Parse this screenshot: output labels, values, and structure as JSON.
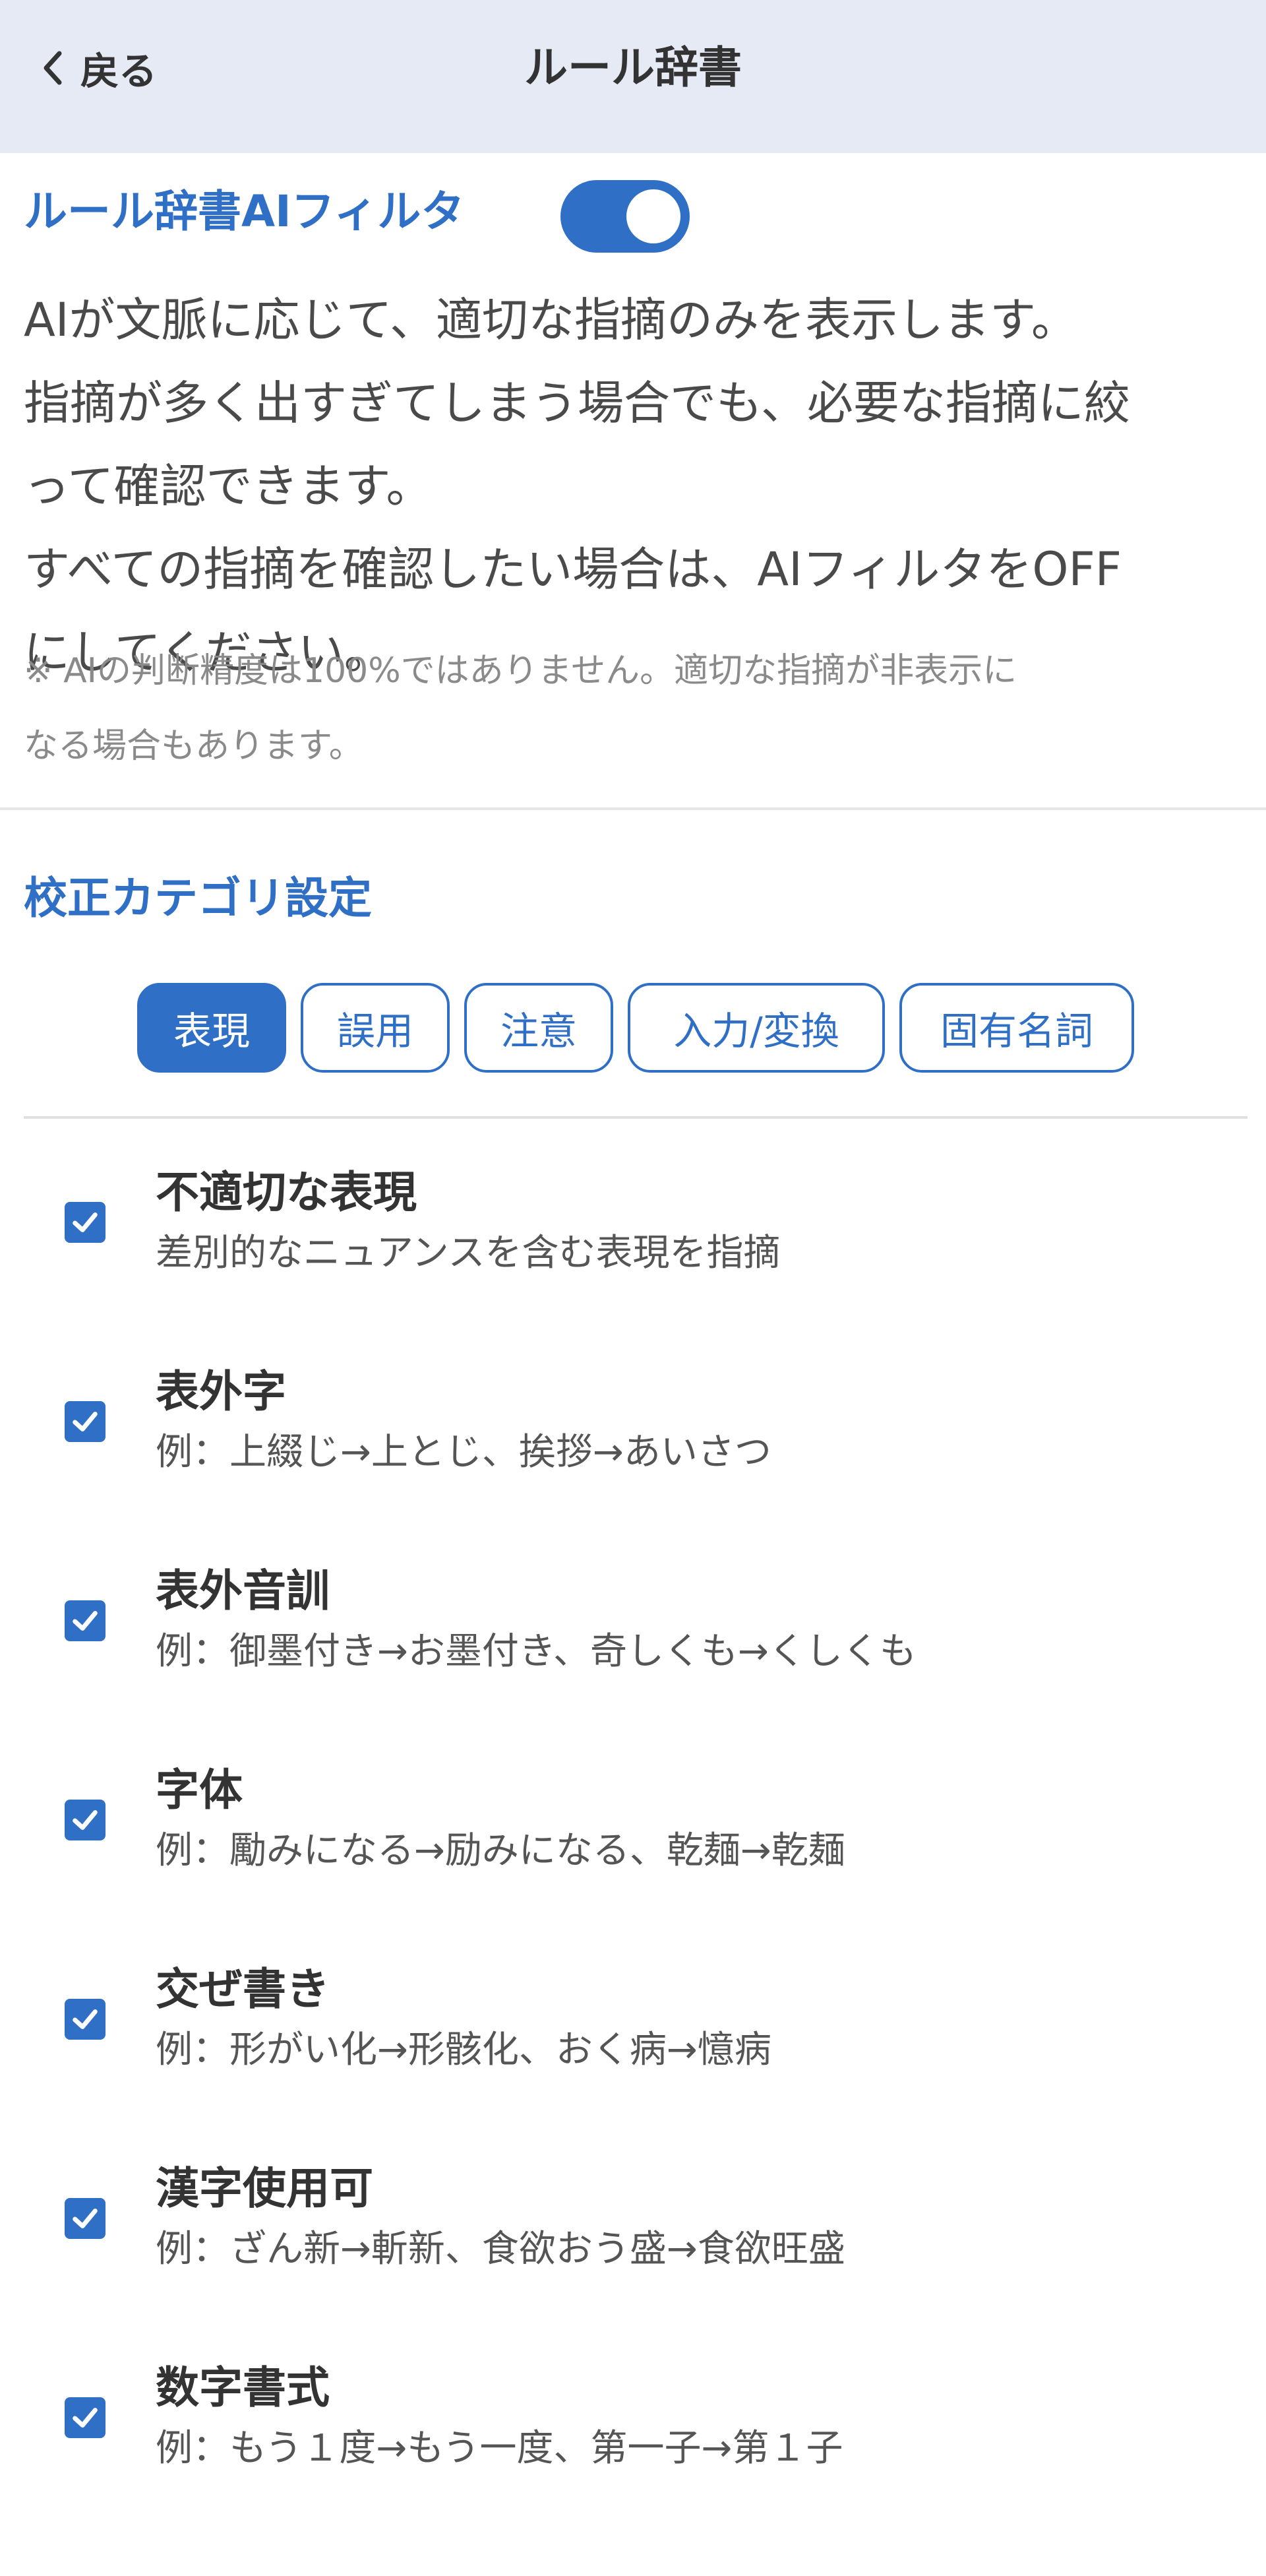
{
  "header": {
    "back_label": "戻る",
    "title": "ルール辞書"
  },
  "ai_filter": {
    "title": "ルール辞書AIフィルタ",
    "toggle_on": true,
    "description_lines": [
      "AIが文脈に応じて、適切な指摘のみを表示します。",
      "指摘が多く出すぎてしまう場合でも、必要な指摘に絞",
      "って確認できます。",
      "すべての指摘を確認したい場合は、AIフィルタをOFF",
      "にしてください。"
    ],
    "note_lines": [
      "※ AIの判断精度は100%ではありません。適切な指摘が非表示に",
      "なる場合もあります。"
    ]
  },
  "category": {
    "title": "校正カテゴリ設定",
    "tabs": [
      "表現",
      "誤用",
      "注意",
      "入力/変換",
      "固有名詞"
    ],
    "active_tab": 0
  },
  "items": [
    {
      "title": "不適切な表現",
      "desc": "差別的なニュアンスを含む表現を指摘",
      "checked": true
    },
    {
      "title": "表外字",
      "desc": "例：上綴じ→上とじ、挨拶→あいさつ",
      "checked": true
    },
    {
      "title": "表外音訓",
      "desc": "例：御墨付き→お墨付き、奇しくも→くしくも",
      "checked": true
    },
    {
      "title": "字体",
      "desc": "例：勵みになる→励みになる、乾麺→乾麺",
      "checked": true
    },
    {
      "title": "交ぜ書き",
      "desc": "例：形がい化→形骸化、おく病→憶病",
      "checked": true
    },
    {
      "title": "漢字使用可",
      "desc": "例：ざん新→斬新、食欲おう盛→食欲旺盛",
      "checked": true
    },
    {
      "title": "数字書式",
      "desc": "例：もう１度→もう一度、第一子→第１子",
      "checked": true
    }
  ],
  "colors": {
    "accent": "#2f6fc6",
    "header_bg": "#e5eaf4"
  }
}
